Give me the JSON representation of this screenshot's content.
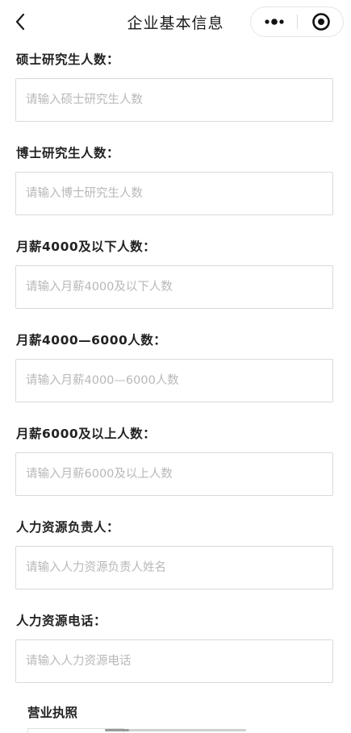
{
  "navbar": {
    "title": "企业基本信息"
  },
  "fields": [
    {
      "label": "硕士研究生人数：",
      "placeholder": "请输入硕士研究生人数",
      "value": ""
    },
    {
      "label": "博士研究生人数：",
      "placeholder": "请输入博士研究生人数",
      "value": ""
    },
    {
      "label": "月薪4000及以下人数：",
      "placeholder": "请输入月薪4000及以下人数",
      "value": ""
    },
    {
      "label": "月薪4000—6000人数：",
      "placeholder": "请输入月薪4000—6000人数",
      "value": ""
    },
    {
      "label": "月薪6000及以上人数：",
      "placeholder": "请输入月薪6000及以上人数",
      "value": ""
    },
    {
      "label": "人力资源负责人：",
      "placeholder": "请输入人力资源负责人姓名",
      "value": ""
    },
    {
      "label": "人力资源电话：",
      "placeholder": "请输入人力资源电话",
      "value": ""
    }
  ],
  "license": {
    "label": "营业执照"
  },
  "icons": {
    "back": "chevron-left-icon",
    "more": "more-dots-icon",
    "close": "target-close-icon"
  }
}
